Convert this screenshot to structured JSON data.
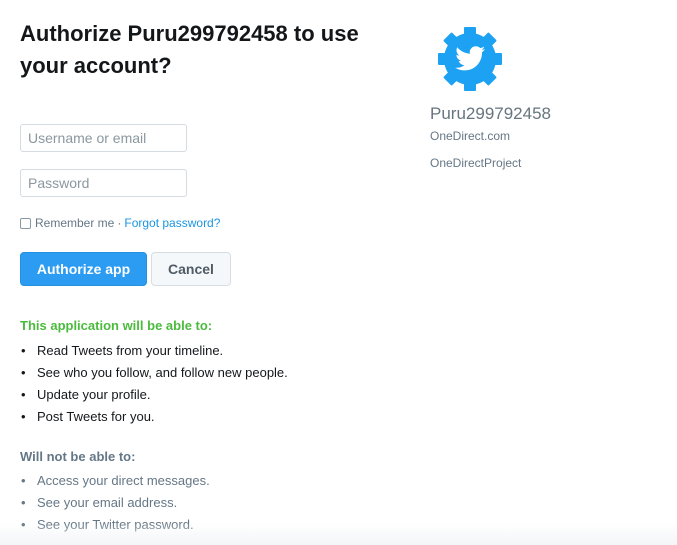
{
  "title": "Authorize Puru299792458 to use your account?",
  "form": {
    "username_placeholder": "Username or email",
    "password_placeholder": "Password",
    "remember_label": "Remember me",
    "separator": "·",
    "forgot_label": "Forgot password?"
  },
  "buttons": {
    "authorize_label": "Authorize app",
    "cancel_label": "Cancel"
  },
  "permissions": {
    "able_heading": "This application will be able to:",
    "able_items": [
      "Read Tweets from your timeline.",
      "See who you follow, and follow new people.",
      "Update your profile.",
      "Post Tweets for you."
    ],
    "not_able_heading": "Will not be able to:",
    "not_able_items": [
      "Access your direct messages.",
      "See your email address.",
      "See your Twitter password."
    ],
    "bullet": "•"
  },
  "app": {
    "name": "Puru299792458",
    "website": "OneDirect.com",
    "organization": "OneDirectProject",
    "logo_icon": "gear-bird-icon",
    "logo_color": "#1da1f2"
  },
  "colors": {
    "accent": "#2b9cf2",
    "link": "#1b95e0",
    "success": "#4bbb3d",
    "muted": "#657786"
  }
}
